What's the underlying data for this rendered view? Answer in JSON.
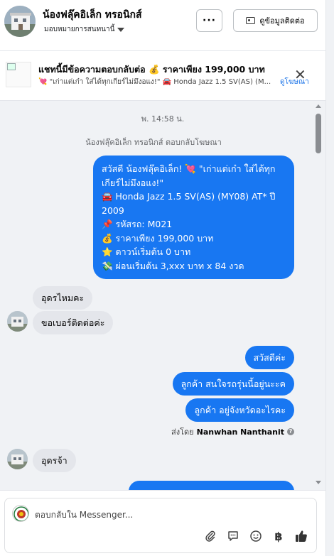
{
  "header": {
    "page_name": "น้องฟลุ๊คอิเล็ก ทรอนิกส์",
    "assign_label": "มอบหมายการสนทนานี้",
    "more_label": "···",
    "contact_label": "ดูข้อมูลติดต่อ"
  },
  "banner": {
    "title": "แชทนี้มีข้อความตอบกลับต่อ 💰 ราคาเพียง 199,000 บาท",
    "subtitle": "💘 \"เก่าแต่เก๋า ใส่ได้ทุกเกียร์ไม่มึงอแง!\" 🚘 Honda Jazz 1.5 SV(AS) (M...",
    "link_label": "ดูโฆษณา",
    "close_label": "✕"
  },
  "chat": {
    "timestamp": "พ. 14:58 น.",
    "system_note": "น้องฟลุ๊คอิเล็ก ทรอนิกส์ ตอบกลับโฆษณา",
    "ad_reply_lines": [
      "สวัสดี น้องฟลุ๊คอิเล็ก! 💘 \"เก่าแต่เก๋า ใส่ได้ทุกเกียร์ไม่มึงอแง!\"",
      "🚘 Honda Jazz 1.5 SV(AS) (MY08) AT* ปี 2009",
      "📌 รหัสรถ: M021",
      "💰 ราคาเพียง 199,000 บาท",
      "⭐ ดาวน์เริ่มต้น 0 บาท",
      "💸 ผ่อนเริ่มต้น 3,xxx บาท x 84 งวด"
    ],
    "msg_udon_question": "อุดรไหมคะ",
    "msg_ask_number": "ขอเบอร์ติดต่อค่ะ",
    "msg_hello": "สวัสดีค่ะ",
    "msg_interest": "ลูกค้า สนใจรถรุ่นนี้อยู่นะะค",
    "msg_province": "ลูกค้า อยู่จังหวัดอะไรคะ",
    "sent_by_prefix": "ส่งโดย",
    "sent_by_name": "Nanwhan Nanthanit",
    "msg_udon_reply": "อุดรจ้า"
  },
  "composer": {
    "placeholder": "ตอบกลับใน Messenger...",
    "tools": [
      "paperclip-icon",
      "chat-bubble-icon",
      "emoji-icon",
      "baht-icon",
      "thumbs-up-icon"
    ],
    "baht_symbol": "฿"
  },
  "colors": {
    "outgoing_bubble": "#1877f2",
    "incoming_bubble": "#e4e6eb",
    "chat_background": "#f0f2f5",
    "link": "#1a73e8"
  }
}
